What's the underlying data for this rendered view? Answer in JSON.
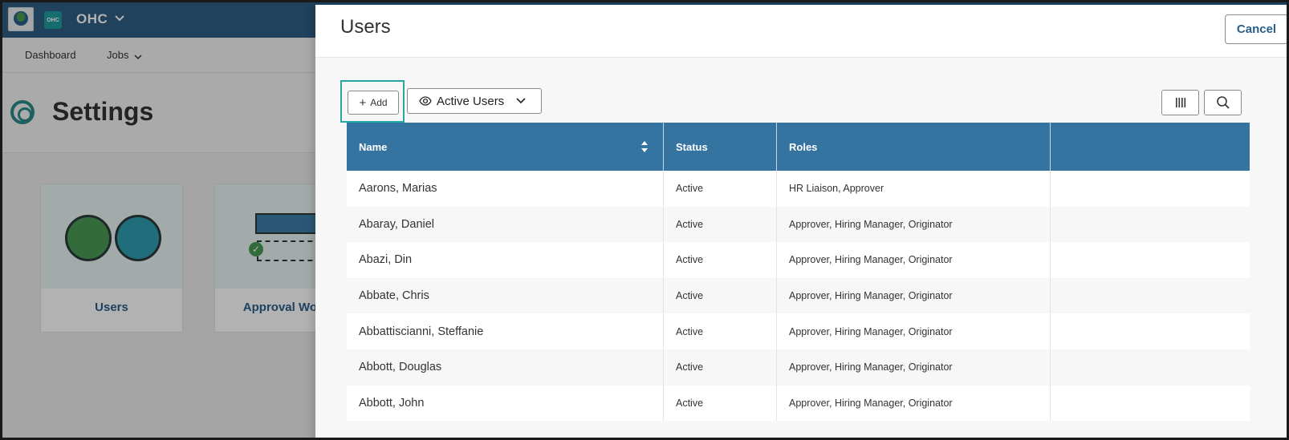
{
  "app": {
    "badge": "OHC",
    "title": "OHC",
    "nav": [
      "Dashboard",
      "Jobs"
    ],
    "page_title": "Settings",
    "cards": [
      {
        "label": "Users"
      },
      {
        "label": "Approval Work"
      }
    ]
  },
  "panel": {
    "title": "Users",
    "cancel_label": "Cancel",
    "add_label": "Add",
    "filter_label": "Active Users"
  },
  "table": {
    "columns": [
      "Name",
      "Status",
      "Roles"
    ],
    "rows": [
      {
        "name": "Aarons, Marias",
        "status": "Active",
        "roles": "HR Liaison, Approver"
      },
      {
        "name": "Abaray, Daniel",
        "status": "Active",
        "roles": "Approver, Hiring Manager, Originator"
      },
      {
        "name": "Abazi, Din",
        "status": "Active",
        "roles": "Approver, Hiring Manager, Originator"
      },
      {
        "name": "Abbate, Chris",
        "status": "Active",
        "roles": "Approver, Hiring Manager, Originator"
      },
      {
        "name": "Abbattiscianni, Steffanie",
        "status": "Active",
        "roles": "Approver, Hiring Manager, Originator"
      },
      {
        "name": "Abbott, Douglas",
        "status": "Active",
        "roles": "Approver, Hiring Manager, Originator"
      },
      {
        "name": "Abbott, John",
        "status": "Active",
        "roles": "Approver, Hiring Manager, Originator"
      }
    ]
  },
  "colors": {
    "topbar": "#2f5f86",
    "table_header": "#3573a0",
    "accent_teal": "#24a8a0",
    "link_blue": "#2a5f8a"
  }
}
